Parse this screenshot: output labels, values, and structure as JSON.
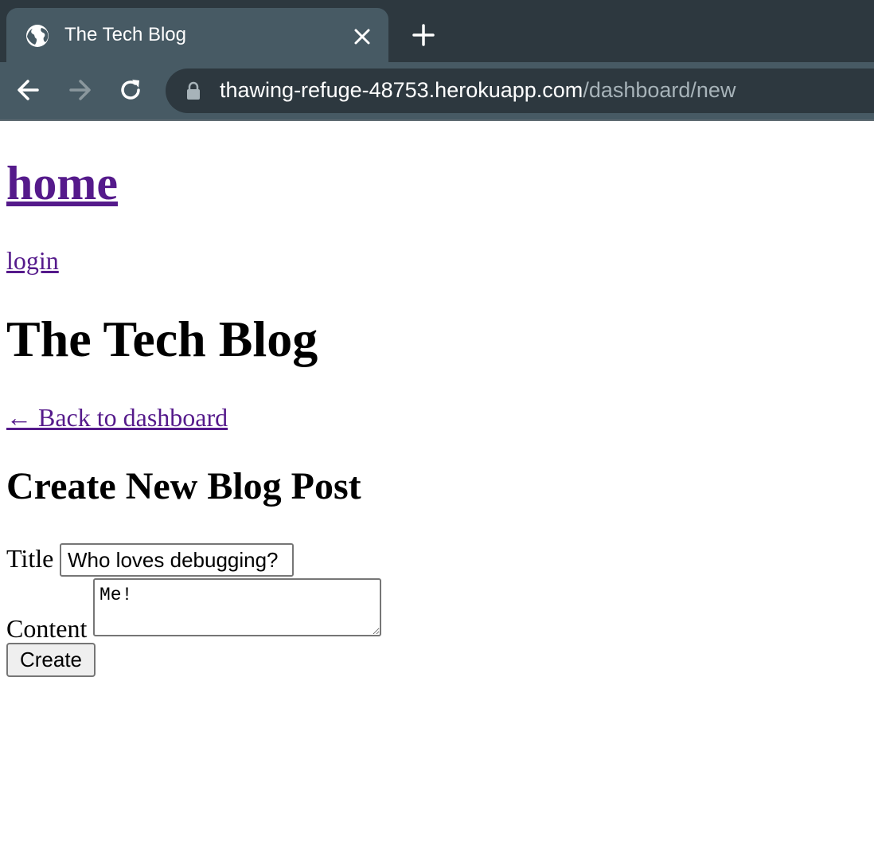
{
  "browser": {
    "tab_title": "The Tech Blog",
    "url_host": "thawing-refuge-48753.herokuapp.com",
    "url_path": "/dashboard/new"
  },
  "nav": {
    "home_label": "home",
    "login_label": "login"
  },
  "site": {
    "title": "The Tech Blog"
  },
  "dashboard": {
    "back_label": "← Back to dashboard"
  },
  "form": {
    "heading": "Create New Blog Post",
    "title_label": "Title",
    "title_value": "Who loves debugging?",
    "content_label": "Content",
    "content_value": "Me!",
    "submit_label": "Create"
  }
}
